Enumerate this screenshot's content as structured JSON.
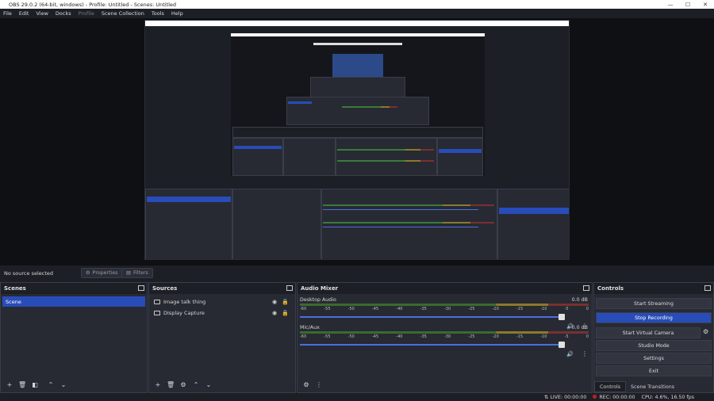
{
  "window": {
    "title": "OBS 29.0.2 (64-bit, windows) - Profile: Untitled - Scenes: Untitled",
    "min": "—",
    "max": "☐",
    "close": "✕"
  },
  "menu": [
    "File",
    "Edit",
    "View",
    "Docks",
    "Profile",
    "Scene Collection",
    "Tools",
    "Help"
  ],
  "source_bar": {
    "no_source": "No source selected",
    "properties": "Properties",
    "filters": "Filters"
  },
  "scenes": {
    "title": "Scenes",
    "items": [
      "Scene"
    ]
  },
  "sources": {
    "title": "Sources",
    "items": [
      {
        "name": "Image talk thing",
        "icon": "image-icon"
      },
      {
        "name": "Display Capture",
        "icon": "monitor-icon"
      }
    ]
  },
  "mixer": {
    "title": "Audio Mixer",
    "ticks": [
      "-60",
      "-55",
      "-50",
      "-45",
      "-40",
      "-35",
      "-30",
      "-25",
      "-20",
      "-15",
      "-10",
      "-5",
      "0"
    ],
    "channels": [
      {
        "name": "Desktop Audio",
        "db": "0.0 dB",
        "volume": 1.0
      },
      {
        "name": "Mic/Aux",
        "db": "0.0 dB",
        "volume": 1.0
      }
    ]
  },
  "controls": {
    "title": "Controls",
    "start_streaming": "Start Streaming",
    "stop_recording": "Stop Recording",
    "start_virtual_camera": "Start Virtual Camera",
    "studio_mode": "Studio Mode",
    "settings": "Settings",
    "exit": "Exit",
    "tab_controls": "Controls",
    "tab_transitions": "Scene Transitions"
  },
  "status": {
    "live": "LIVE: 00:00:00",
    "rec": "REC: 00:00:00",
    "cpu": "CPU: 4.6%, 16.50 fps"
  },
  "colors": {
    "accent": "#284cb8",
    "bg": "#1d1f26",
    "panel": "#272a33"
  }
}
